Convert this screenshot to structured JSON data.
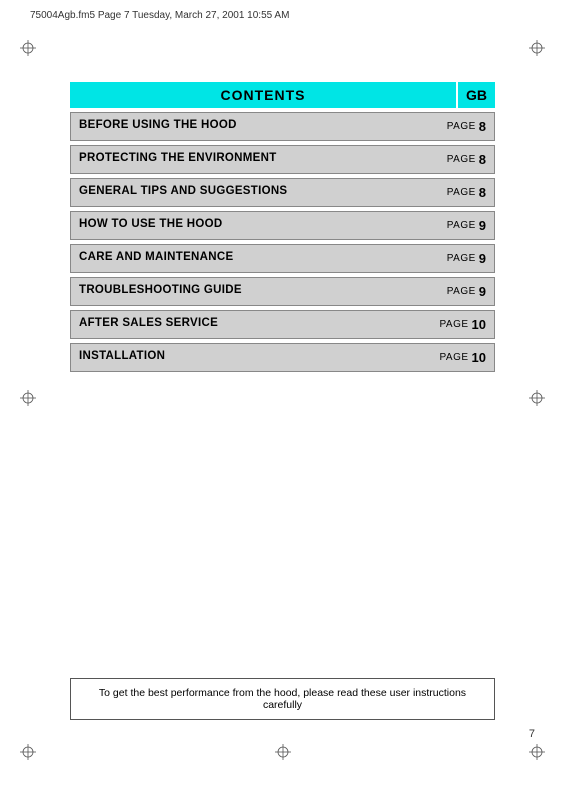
{
  "header": {
    "file_info": "75004Agb.fm5  Page 7  Tuesday, March 27, 2001  10:55 AM"
  },
  "title": {
    "label": "CONTENTS",
    "gb_label": "GB"
  },
  "rows": [
    {
      "label": "BEFORE USING THE HOOD",
      "page_label": "PAGE",
      "page_num": "8"
    },
    {
      "label": "PROTECTING THE ENVIRONMENT",
      "page_label": "PAGE",
      "page_num": "8"
    },
    {
      "label": "GENERAL TIPS AND SUGGESTIONS",
      "page_label": "PAGE",
      "page_num": "8"
    },
    {
      "label": "HOW TO USE THE HOOD",
      "page_label": "PAGE",
      "page_num": "9"
    },
    {
      "label": "CARE AND MAINTENANCE",
      "page_label": "PAGE",
      "page_num": "9"
    },
    {
      "label": "TROUBLESHOOTING GUIDE",
      "page_label": "PAGE",
      "page_num": "9"
    },
    {
      "label": "AFTER SALES SERVICE",
      "page_label": "PAGE",
      "page_num": "10"
    },
    {
      "label": "INSTALLATION",
      "page_label": "PAGE",
      "page_num": "10"
    }
  ],
  "notice": {
    "text": "To get the best performance from the hood, please read these user instructions carefully"
  },
  "page_number": "7"
}
